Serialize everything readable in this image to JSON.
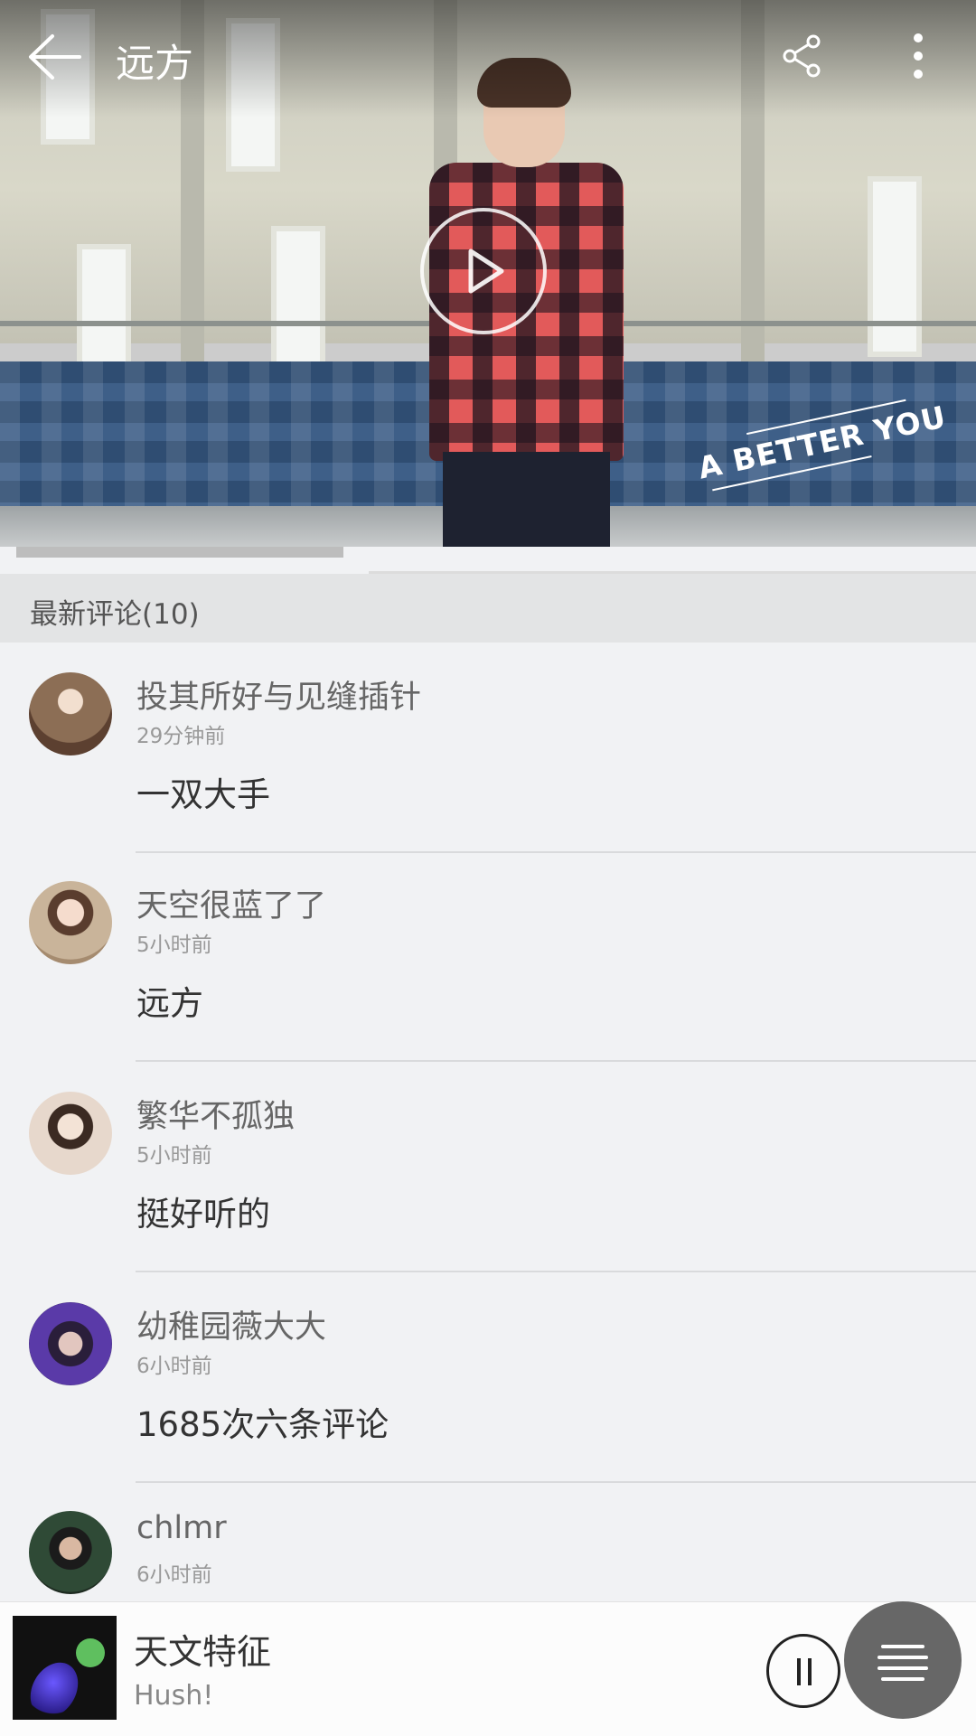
{
  "header": {
    "title": "远方",
    "watermark": "A BETTER YOU"
  },
  "comments_section": {
    "title": "最新评论(10)"
  },
  "comments": [
    {
      "user": "投其所好与见缝插针",
      "time": "29分钟前",
      "text": "一双大手",
      "avatar_color": "#8c6e55"
    },
    {
      "user": "天空很蓝了了",
      "time": "5小时前",
      "text": "远方",
      "avatar_color": "#c9b49a"
    },
    {
      "user": "繁华不孤独",
      "time": "5小时前",
      "text": "挺好听的",
      "avatar_color": "#e7d8cc"
    },
    {
      "user": "幼稚园薇大大",
      "time": "6小时前",
      "text": "1685次六条评论",
      "avatar_color": "#5a3aa8"
    },
    {
      "user": "chlmr",
      "time": "6小时前",
      "text": "",
      "avatar_color": "#2f4a36"
    }
  ],
  "player": {
    "song": "天文特征",
    "artist": "Hush!"
  },
  "icons": [
    "back-arrow-icon",
    "share-icon",
    "more-vertical-icon",
    "play-icon",
    "pause-icon",
    "playlist-icon"
  ]
}
